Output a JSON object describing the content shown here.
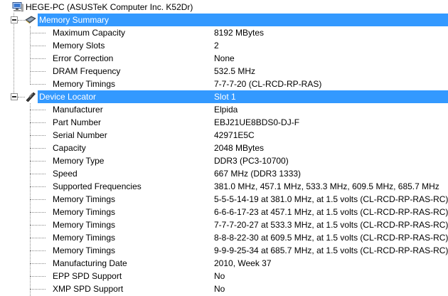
{
  "root": {
    "label": "HEGE-PC (ASUSTeK Computer Inc. K52Dr)",
    "icon": "computer-icon"
  },
  "sections": [
    {
      "label": "Memory Summary",
      "value": "",
      "icon": "memory-module-icon",
      "rows": [
        {
          "label": "Maximum Capacity",
          "value": "8192 MBytes"
        },
        {
          "label": "Memory Slots",
          "value": "2"
        },
        {
          "label": "Error Correction",
          "value": "None"
        },
        {
          "label": "DRAM Frequency",
          "value": "532.5 MHz"
        },
        {
          "label": "Memory Timings",
          "value": "7-7-7-20 (CL-RCD-RP-RAS)"
        }
      ]
    },
    {
      "label": "Device Locator",
      "value": "Slot 1",
      "icon": "memory-stick-icon",
      "rows": [
        {
          "label": "Manufacturer",
          "value": "Elpida"
        },
        {
          "label": "Part Number",
          "value": "EBJ21UE8BDS0-DJ-F"
        },
        {
          "label": "Serial Number",
          "value": "42971E5C"
        },
        {
          "label": "Capacity",
          "value": "2048 MBytes"
        },
        {
          "label": "Memory Type",
          "value": "DDR3 (PC3-10700)"
        },
        {
          "label": "Speed",
          "value": "667 MHz (DDR3 1333)"
        },
        {
          "label": "Supported Frequencies",
          "value": "381.0 MHz, 457.1 MHz, 533.3 MHz, 609.5 MHz, 685.7 MHz"
        },
        {
          "label": "Memory Timings",
          "value": "5-5-5-14-19 at 381.0 MHz, at 1.5 volts (CL-RCD-RP-RAS-RC)"
        },
        {
          "label": "Memory Timings",
          "value": "6-6-6-17-23 at 457.1 MHz, at 1.5 volts (CL-RCD-RP-RAS-RC)"
        },
        {
          "label": "Memory Timings",
          "value": "7-7-7-20-27 at 533.3 MHz, at 1.5 volts (CL-RCD-RP-RAS-RC)"
        },
        {
          "label": "Memory Timings",
          "value": "8-8-8-22-30 at 609.5 MHz, at 1.5 volts (CL-RCD-RP-RAS-RC)"
        },
        {
          "label": "Memory Timings",
          "value": "9-9-9-25-34 at 685.7 MHz, at 1.5 volts (CL-RCD-RP-RAS-RC)"
        },
        {
          "label": "Manufacturing Date",
          "value": "2010, Week 37"
        },
        {
          "label": "EPP SPD Support",
          "value": "No"
        },
        {
          "label": "XMP SPD Support",
          "value": "No"
        }
      ]
    }
  ],
  "colors": {
    "selection": "#3399ff",
    "tree_lines": "#8a8a8a"
  }
}
